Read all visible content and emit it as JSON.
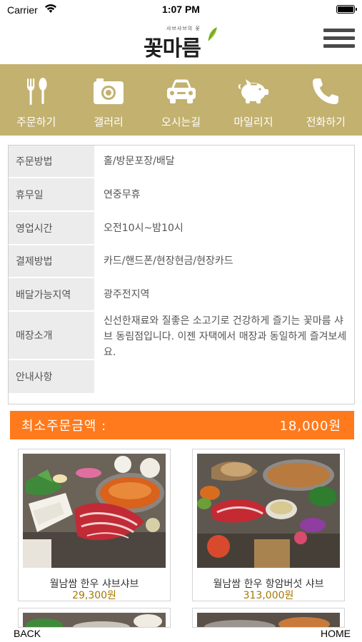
{
  "status_bar": {
    "carrier": "Carrier",
    "time": "1:07 PM"
  },
  "header": {
    "logo_subtitle": "샤브샤브의 꽃",
    "logo_text": "꽃마름"
  },
  "nav": [
    {
      "label": "주문하기",
      "icon": "fork-spoon-icon"
    },
    {
      "label": "갤러리",
      "icon": "camera-icon"
    },
    {
      "label": "오시는길",
      "icon": "car-icon"
    },
    {
      "label": "마일리지",
      "icon": "piggy-bank-icon"
    },
    {
      "label": "전화하기",
      "icon": "phone-icon"
    }
  ],
  "info": [
    {
      "key": "주문방법",
      "value": "홀/방문포장/배달"
    },
    {
      "key": "휴무일",
      "value": "연중무휴"
    },
    {
      "key": "영업시간",
      "value": "오전10시~밤10시"
    },
    {
      "key": "결제방법",
      "value": "카드/핸드폰/현장현금/현장카드"
    },
    {
      "key": "배달가능지역",
      "value": "광주전지역"
    },
    {
      "key": "매장소개",
      "value": "신선한재료와 질좋은 소고기로 건강하게 즐기는 꽃마름 샤브 동림점입니다. 이젠 자택에서 매장과 동일하게 즐겨보세요."
    },
    {
      "key": "안내사항",
      "value": ""
    }
  ],
  "min_order": {
    "label": "최소주문금액 :",
    "amount": "18,000원"
  },
  "products": [
    {
      "name": "월남쌈 한우 샤브샤브",
      "price": "29,300원"
    },
    {
      "name": "월남쌈 한우 항암버섯 샤브",
      "price": "313,000원"
    }
  ],
  "bottom": {
    "back": "BACK",
    "home": "HOME"
  },
  "colors": {
    "nav_bg": "#c3b16f",
    "accent_orange": "#ff7a1c",
    "price": "#a37800"
  }
}
